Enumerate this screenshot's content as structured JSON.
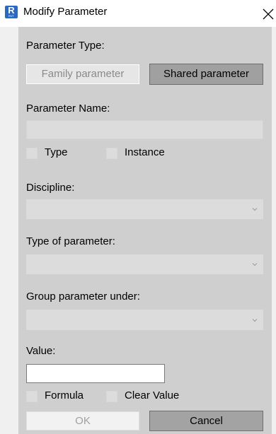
{
  "window": {
    "title": "Modify Parameter",
    "app_icon_letter": "R",
    "app_icon_sub": "RVT"
  },
  "labels": {
    "parameter_type": "Parameter Type:",
    "parameter_name": "Parameter Name:",
    "discipline": "Discipline:",
    "type_of_parameter": "Type of parameter:",
    "group_parameter_under": "Group parameter under:",
    "value": "Value:"
  },
  "buttons": {
    "family_parameter": "Family parameter",
    "shared_parameter": "Shared parameter",
    "ok": "OK",
    "cancel": "Cancel"
  },
  "checkboxes": {
    "type": "Type",
    "instance": "Instance",
    "formula": "Formula",
    "clear_value": "Clear Value"
  },
  "fields": {
    "parameter_name_value": "",
    "discipline_value": "",
    "type_of_parameter_value": "",
    "group_parameter_under_value": "",
    "value_value": ""
  },
  "colors": {
    "panel_background": "#cfcfcf",
    "window_background": "#f0f0f0",
    "app_icon": "#2b67c6"
  }
}
